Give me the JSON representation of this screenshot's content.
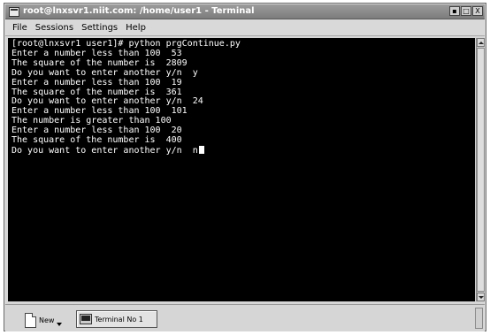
{
  "window": {
    "title": "root@lnxsvr1.niit.com: /home/user1 - Terminal",
    "buttons": [
      "▪",
      "□",
      "X"
    ]
  },
  "menu": [
    "File",
    "Sessions",
    "Settings",
    "Help"
  ],
  "terminal": {
    "lines": [
      "[root@lnxsvr1 user1]# python prgContinue.py",
      "Enter a number less than 100  53",
      "The square of the number is  2809",
      "Do you want to enter another y/n  y",
      "Enter a number less than 100  19",
      "The square of the number is  361",
      "Do you want to enter another y/n  24",
      "Enter a number less than 100  101",
      "The number is greater than 100",
      "Enter a number less than 100  20",
      "The square of the number is  400",
      "Do you want to enter another y/n  n"
    ]
  },
  "bottombar": {
    "new_label": "New",
    "session_tab": "Terminal No 1"
  }
}
